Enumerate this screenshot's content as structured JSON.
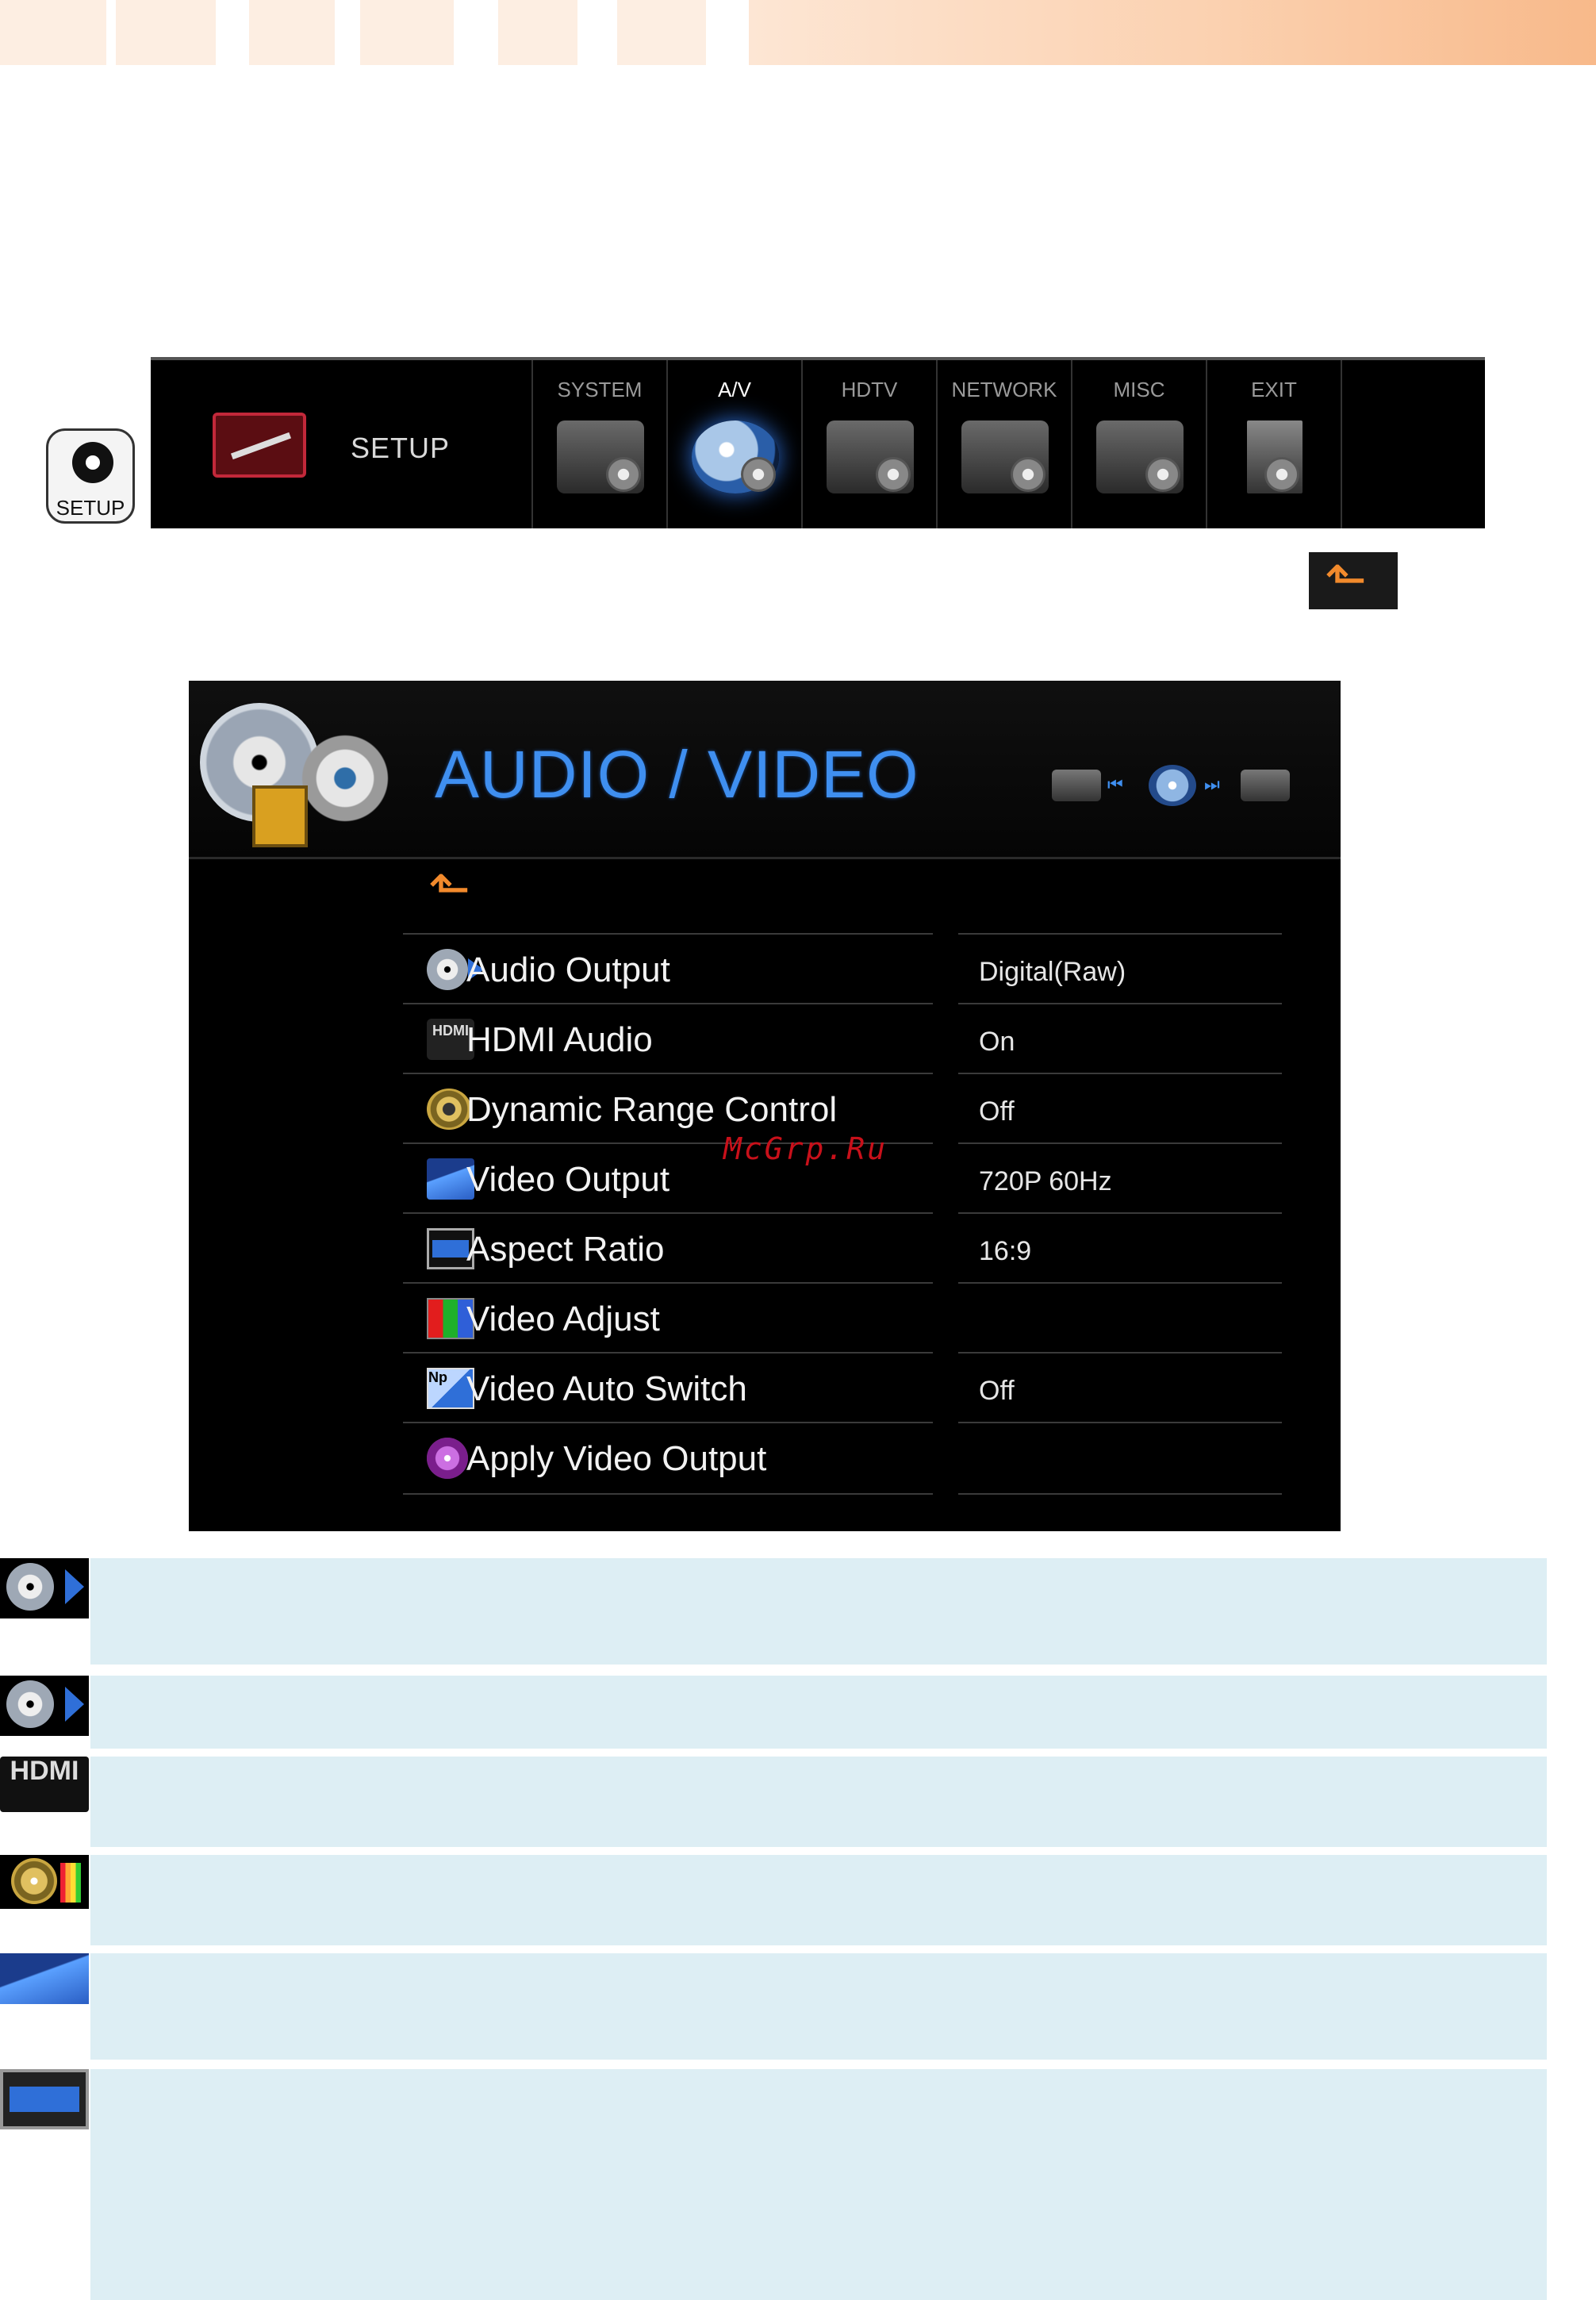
{
  "remote": {
    "setup_label": "SETUP"
  },
  "setup_bar": {
    "title": "SETUP",
    "tabs": [
      {
        "label": "SYSTEM",
        "icon": "system-gear-icon"
      },
      {
        "label": "A/V",
        "icon": "av-disc-icon",
        "active": true
      },
      {
        "label": "HDTV",
        "icon": "hdtv-gear-icon"
      },
      {
        "label": "NETWORK",
        "icon": "network-gear-icon"
      },
      {
        "label": "MISC",
        "icon": "misc-gear-icon"
      },
      {
        "label": "EXIT",
        "icon": "exit-door-icon"
      }
    ]
  },
  "panel": {
    "title": "AUDIO / VIDEO",
    "rows": [
      {
        "label": "Audio Output",
        "value": "Digital(Raw)",
        "icon": "disc-arrow-icon"
      },
      {
        "label": "HDMI Audio",
        "value": "On",
        "icon": "hdmi-icon"
      },
      {
        "label": "Dynamic Range Control",
        "value": "Off",
        "icon": "speaker-icon"
      },
      {
        "label": "Video Output",
        "value": "720P 60Hz",
        "icon": "video-screen-icon"
      },
      {
        "label": "Aspect Ratio",
        "value": "16:9",
        "icon": "aspect-screen-icon"
      },
      {
        "label": "Video Adjust",
        "value": "",
        "icon": "rgb-bars-icon"
      },
      {
        "label": "Video Auto Switch",
        "value": "Off",
        "icon": "ntsc-pal-icon"
      },
      {
        "label": "Apply Video Output",
        "value": "",
        "icon": "film-reel-icon"
      }
    ],
    "hdmi_icon_text": "HDMI",
    "auto_icon_text": "Np"
  },
  "watermark": "McGrp.Ru",
  "notes": [
    {
      "icon": "disc-arrow-icon"
    },
    {
      "icon": "disc-arrow-icon"
    },
    {
      "icon": "hdmi-icon",
      "icon_text": "HDMI"
    },
    {
      "icon": "speaker-icon"
    },
    {
      "icon": "video-screen-icon"
    },
    {
      "icon": "aspect-screen-icon"
    }
  ],
  "colors": {
    "accent_blue": "#3f8ff0",
    "back_arrow": "#f28a2c",
    "note_bg": "#ddeef4",
    "watermark": "#c8101a"
  }
}
